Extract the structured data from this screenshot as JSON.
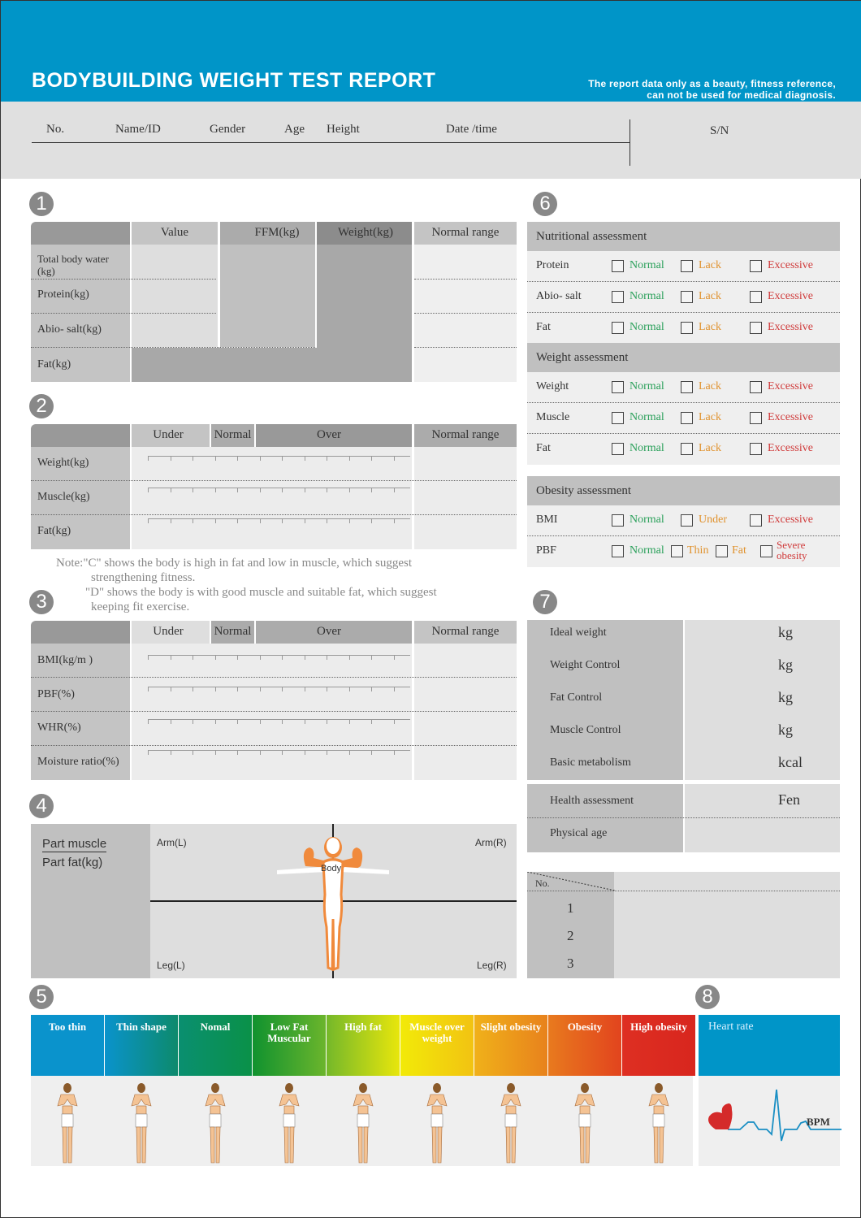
{
  "header": {
    "title": "BODYBUILDING WEIGHT TEST REPORT",
    "disclaimer_line1": "The report data only as a beauty, fitness reference,",
    "disclaimer_line2": "can not be used for medical diagnosis.",
    "fields": [
      "No.",
      "Name/ID",
      "Gender",
      "Age",
      "Height",
      "Date /time"
    ],
    "sn_label": "S/N",
    "brand_color": "#0095c8"
  },
  "section1": {
    "badge": "1",
    "columns": [
      "Value",
      "FFM(kg)",
      "Weight(kg)",
      "Normal range"
    ],
    "rows": [
      "Total body water (kg)",
      "Protein(kg)",
      "Abio- salt(kg)",
      "Fat(kg)"
    ]
  },
  "section2": {
    "badge": "2",
    "columns": [
      "Under",
      "Normal",
      "Over",
      "Normal range"
    ],
    "rows": [
      "Weight(kg)",
      "Muscle(kg)",
      "Fat(kg)"
    ],
    "note_c_line1": "Note:\"C\" shows the body is high in fat and low in muscle,  which suggest",
    "note_c_line2": "strengthening fitness.",
    "note_d_line1": "\"D\" shows the body is with good muscle and suitable fat,  which suggest",
    "note_d_line2": "keeping fit exercise."
  },
  "section3": {
    "badge": "3",
    "columns": [
      "Under",
      "Normal",
      "Over",
      "Normal range"
    ],
    "rows": [
      "BMI(kg/m )",
      "PBF(%)",
      "WHR(%)",
      "Moisture ratio(%)"
    ]
  },
  "section4": {
    "badge": "4",
    "label_top": "Part muscle",
    "label_bottom": "Part fat(kg)",
    "quadrants": [
      "Arm(L)",
      "Arm(R)",
      "Leg(L)",
      "Leg(R)"
    ],
    "center": "Body"
  },
  "section5": {
    "badge": "5",
    "categories": [
      {
        "label": "Too thin",
        "color1": "#0a93cc",
        "color2": "#0a93cc"
      },
      {
        "label": "Thin shape",
        "color1": "#0a93cc",
        "color2": "#0d8a6c"
      },
      {
        "label": "Nomal",
        "color1": "#0a8f70",
        "color2": "#0a9148"
      },
      {
        "label": "Low Fat Muscular",
        "color1": "#10922f",
        "color2": "#6bb52c"
      },
      {
        "label": "High fat",
        "color1": "#74b82a",
        "color2": "#e8e60c"
      },
      {
        "label": "Muscle over weight",
        "color1": "#f2ea08",
        "color2": "#f2c312"
      },
      {
        "label": "Slight obesity",
        "color1": "#f0b11a",
        "color2": "#e8821c"
      },
      {
        "label": "Obesity",
        "color1": "#e87a1e",
        "color2": "#e2441e"
      },
      {
        "label": "High obesity",
        "color1": "#de2f22",
        "color2": "#d8261e"
      }
    ]
  },
  "section6": {
    "badge": "6",
    "groups": [
      {
        "title": "Nutritional assessment",
        "rows": [
          {
            "label": "Protein",
            "options": [
              "Normal",
              "Lack",
              "Excessive"
            ]
          },
          {
            "label": "Abio- salt",
            "options": [
              "Normal",
              "Lack",
              "Excessive"
            ]
          },
          {
            "label": "Fat",
            "options": [
              "Normal",
              "Lack",
              "Excessive"
            ]
          }
        ]
      },
      {
        "title": "Weight assessment",
        "rows": [
          {
            "label": "Weight",
            "options": [
              "Normal",
              "Lack",
              "Excessive"
            ]
          },
          {
            "label": "Muscle",
            "options": [
              "Normal",
              "Lack",
              "Excessive"
            ]
          },
          {
            "label": "Fat",
            "options": [
              "Normal",
              "Lack",
              "Excessive"
            ]
          }
        ]
      },
      {
        "title": "Obesity assessment",
        "rows": [
          {
            "label": "BMI",
            "options": [
              "Normal",
              "Under",
              "Excessive"
            ]
          },
          {
            "label": "PBF",
            "options": [
              "Normal",
              "Thin",
              "Fat",
              "Severe obesity"
            ]
          }
        ]
      }
    ]
  },
  "section7": {
    "badge": "7",
    "rows": [
      {
        "label": "Ideal weight",
        "unit": "kg"
      },
      {
        "label": "Weight Control",
        "unit": "kg"
      },
      {
        "label": "Fat Control",
        "unit": "kg"
      },
      {
        "label": "Muscle Control",
        "unit": "kg"
      },
      {
        "label": "Basic metabolism",
        "unit": "kcal"
      }
    ],
    "health_label": "Health assessment",
    "health_unit": "Fen",
    "physical_age_label": "Physical  age",
    "history_header": "No.",
    "history_rows": [
      "1",
      "2",
      "3"
    ]
  },
  "section8": {
    "badge": "8",
    "title": "Heart rate",
    "unit": "BPM"
  }
}
